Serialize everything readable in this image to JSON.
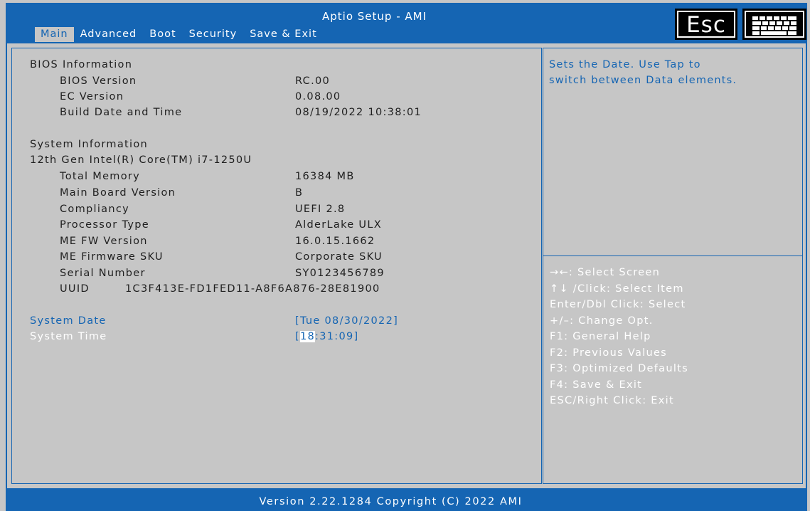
{
  "header": {
    "title": "Aptio Setup - AMI",
    "tabs": [
      "Main",
      "Advanced",
      "Boot",
      "Security",
      "Save & Exit"
    ],
    "active_tab": "Main",
    "esc_label": "Esc",
    "keyboard_icon": "keyboard-icon"
  },
  "bios_info": {
    "heading": "BIOS Information",
    "rows": [
      {
        "label": "BIOS Version",
        "value": "RC.00"
      },
      {
        "label": "EC Version",
        "value": "0.08.00"
      },
      {
        "label": "Build Date and Time",
        "value": "08/19/2022 10:38:01"
      }
    ]
  },
  "system_info": {
    "heading": "System Information",
    "cpu": "12th Gen Intel(R) Core(TM) i7-1250U",
    "rows": [
      {
        "label": "Total Memory",
        "value": "16384 MB"
      },
      {
        "label": "Main Board Version",
        "value": "B"
      },
      {
        "label": "Compliancy",
        "value": "UEFI 2.8"
      },
      {
        "label": "Processor Type",
        "value": "AlderLake ULX"
      },
      {
        "label": "ME FW Version",
        "value": "16.0.15.1662"
      },
      {
        "label": "ME Firmware SKU",
        "value": "Corporate SKU"
      },
      {
        "label": "Serial Number",
        "value": "SY0123456789"
      }
    ],
    "uuid_label": "UUID",
    "uuid_value": "1C3F413E-FD1FED11-A8F6A876-28E81900"
  },
  "settings": {
    "date_label": "System Date",
    "date_value": "[Tue 08/30/2022]",
    "time_label": "System Time",
    "time_open": "[",
    "time_cursor": "18",
    "time_rest": ":31:09]"
  },
  "help": {
    "lines": [
      "Sets the Date. Use Tap to",
      "switch between Data elements."
    ]
  },
  "keys": [
    "→←: Select Screen",
    "↑↓ /Click: Select Item",
    "Enter/Dbl Click: Select",
    "+/–: Change Opt.",
    "F1: General Help",
    "F2: Previous Values",
    "F3: Optimized Defaults",
    "F4: Save & Exit",
    "ESC/Right Click: Exit"
  ],
  "footer": {
    "text": "Version 2.22.1284 Copyright (C) 2022 AMI"
  },
  "colors": {
    "accent_blue": "#1565b3",
    "panel_gray": "#c6c6c6",
    "text_dark": "#1f1f1f",
    "highlight_white": "#ffffff"
  }
}
